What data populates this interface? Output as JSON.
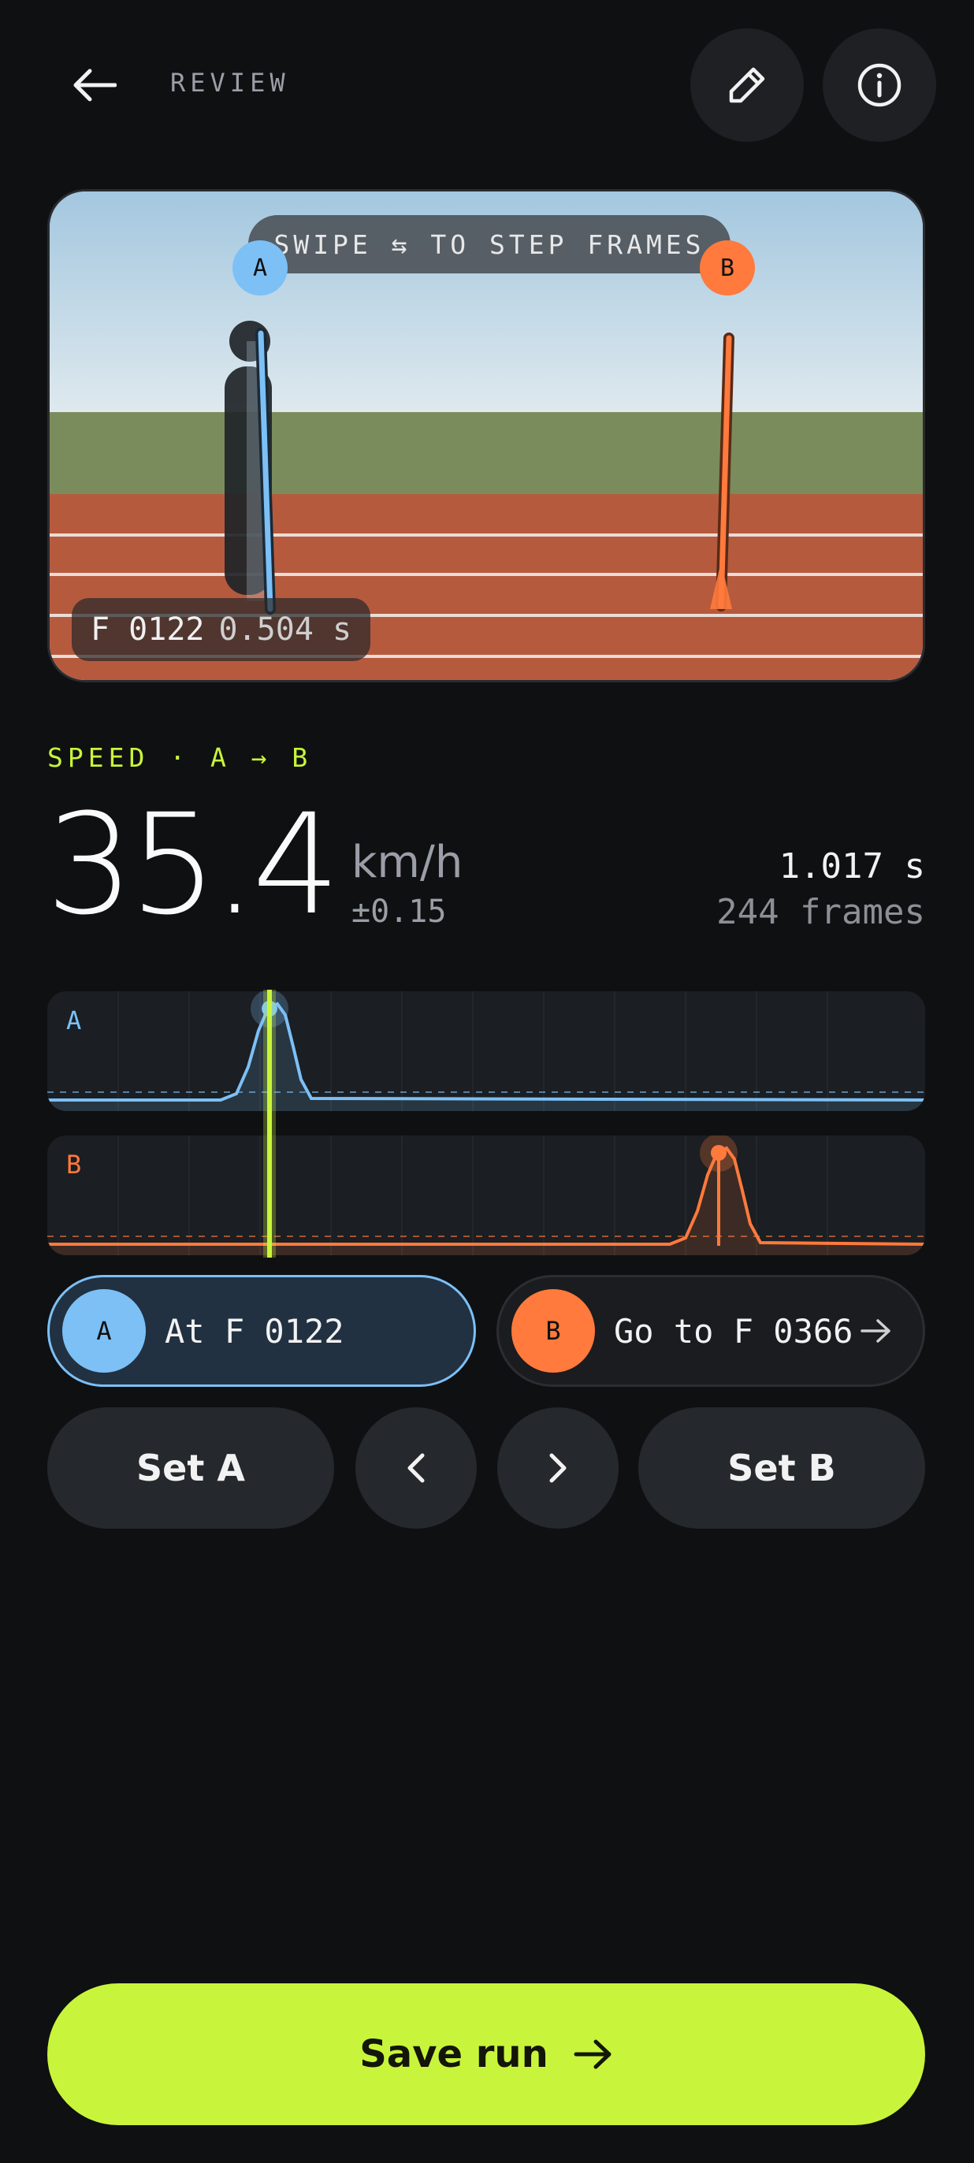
{
  "header": {
    "title": "REVIEW",
    "back_icon": "arrow-left-icon",
    "edit_icon": "pencil-icon",
    "info_icon": "info-icon"
  },
  "video": {
    "hint": "SWIPE ⇆ TO STEP FRAMES",
    "frame_label": "F 0122",
    "time_label": "0.504 s",
    "marker_a": "A",
    "marker_b": "B"
  },
  "speed": {
    "label": "SPEED · A → B",
    "value": "35.4",
    "unit": "km/h",
    "error": "±0.15",
    "duration": "1.017 s",
    "frames": "244 frames"
  },
  "traces": {
    "a_label": "A",
    "b_label": "B",
    "a_peak_frame": 122,
    "b_peak_frame": 366
  },
  "markers": {
    "a_dot": "A",
    "a_text": "At F 0122",
    "b_dot": "B",
    "b_text": "Go to F 0366"
  },
  "controls": {
    "set_a": "Set A",
    "prev": "‹",
    "next": "›",
    "set_b": "Set B"
  },
  "save": {
    "label": "Save run",
    "icon": "arrow-right-icon"
  },
  "colors": {
    "accent": "#c8f53b",
    "marker_a": "#7cc0f6",
    "marker_b": "#ff7a3c",
    "background": "#0f1012"
  }
}
